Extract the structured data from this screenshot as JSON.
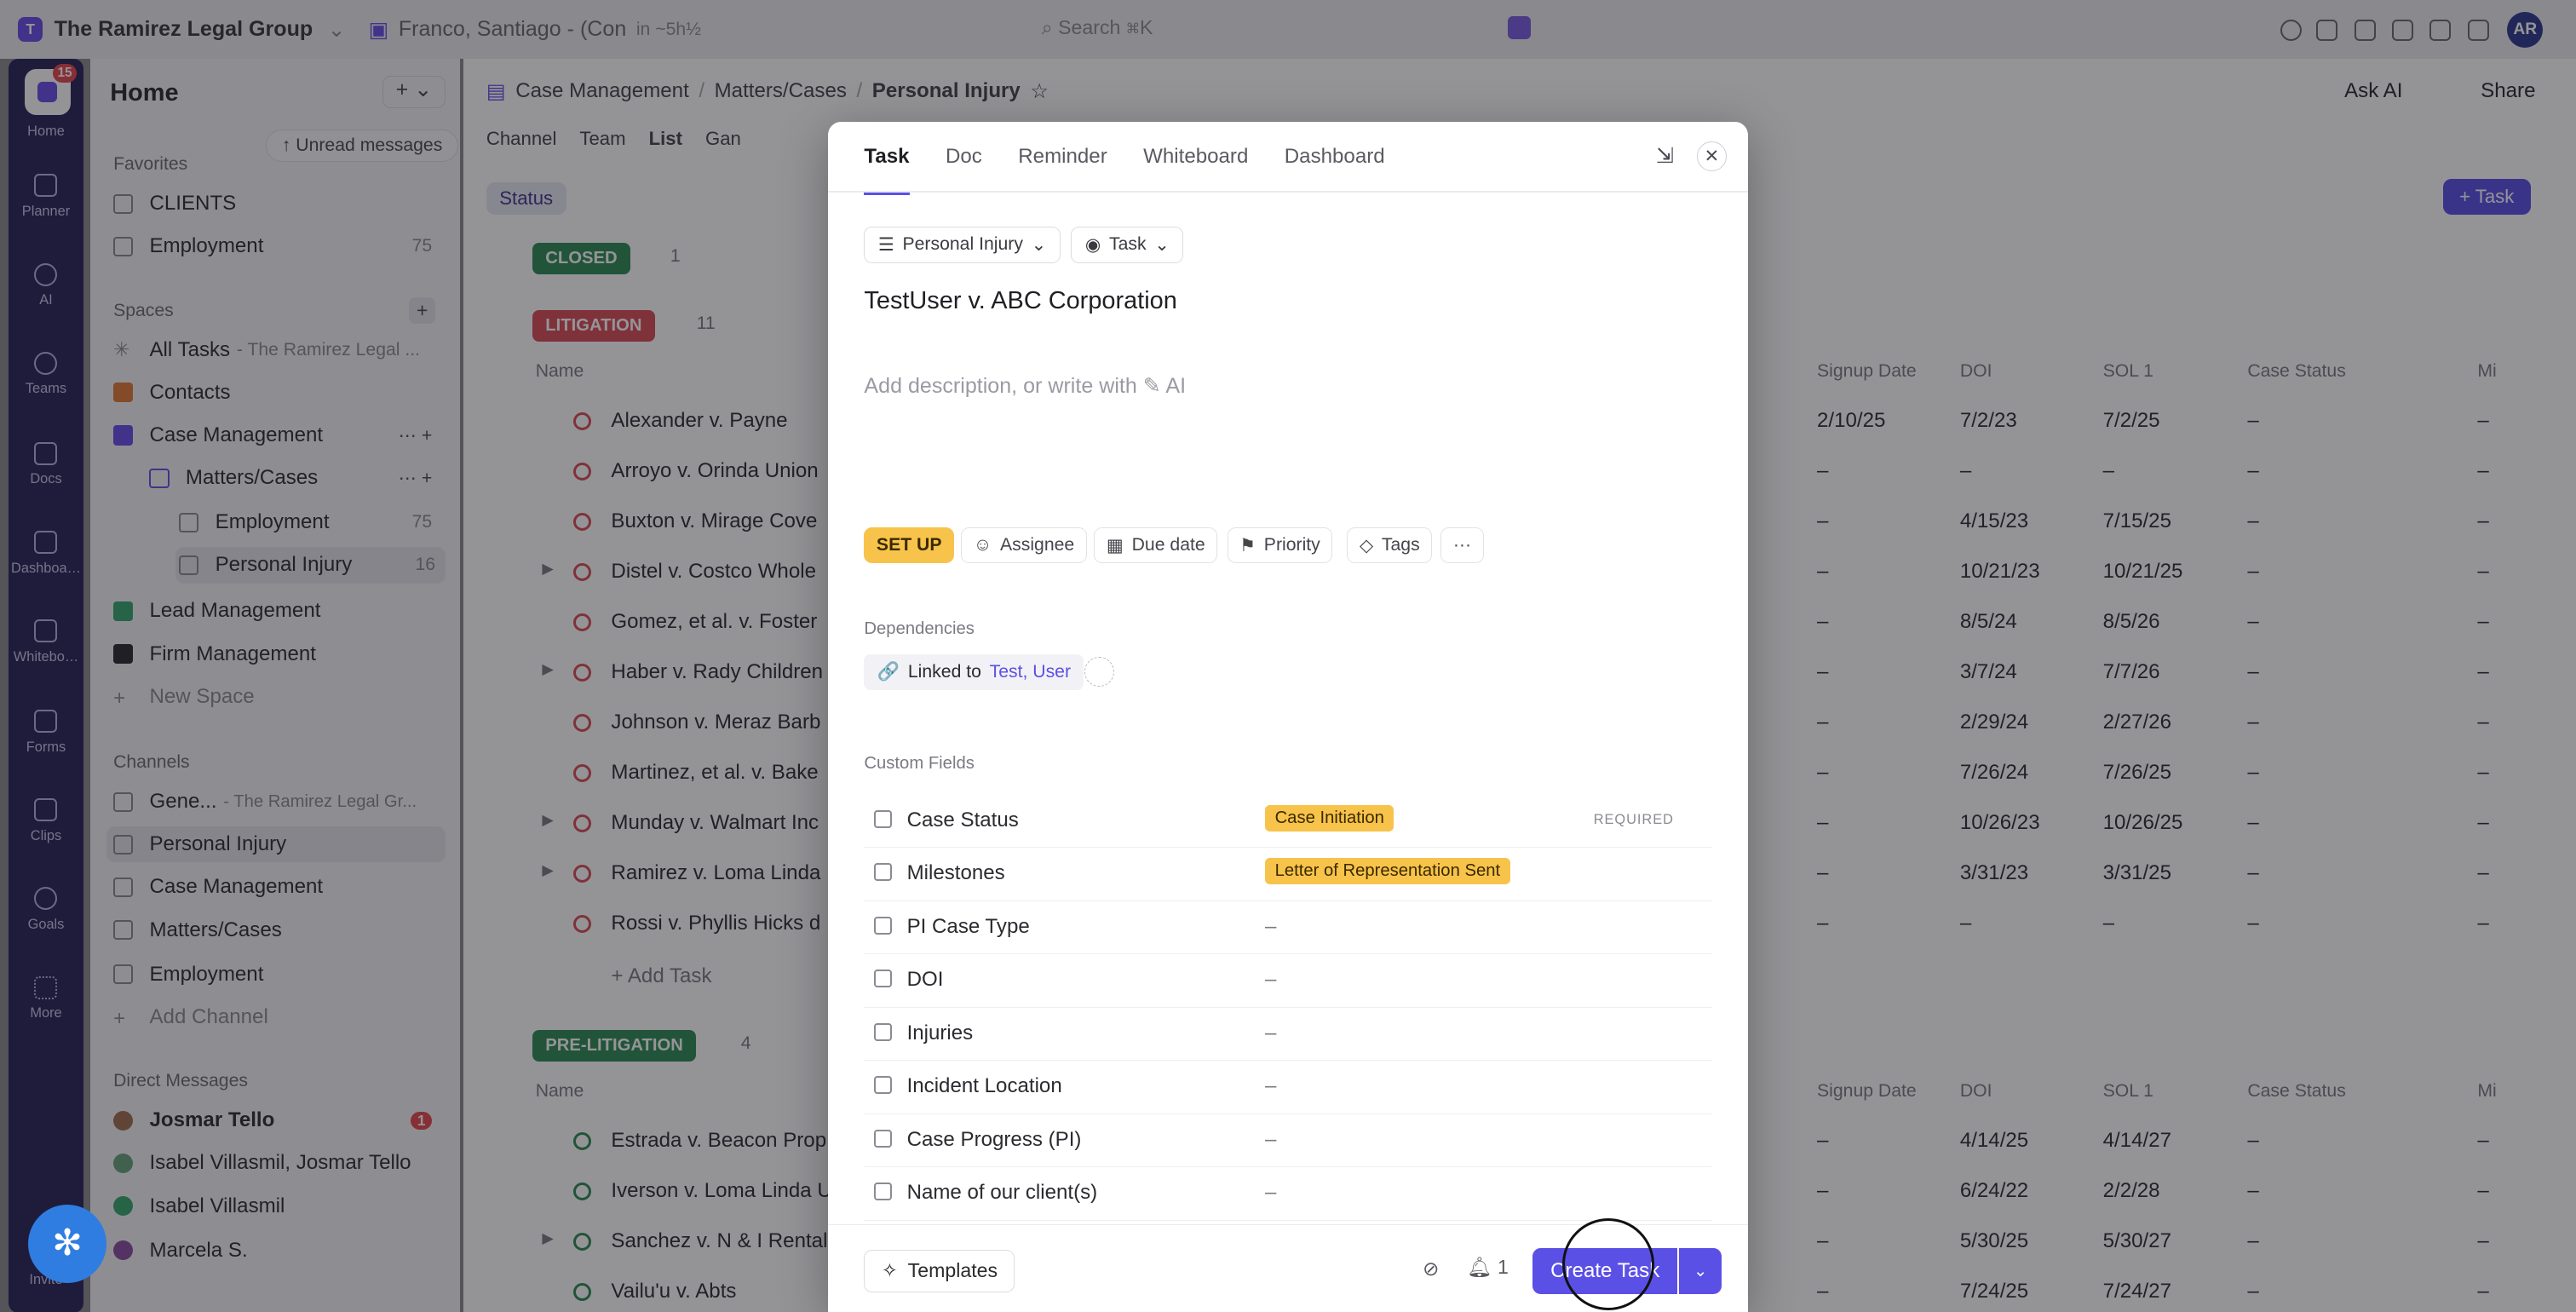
{
  "topbar": {
    "workspace": "The Ramirez Legal Group",
    "workspace_initial": "T",
    "tab": "Franco, Santiago - (Con",
    "tab_time": "in ~5h½",
    "search": "Search ⌘K",
    "avatar": "AR"
  },
  "rail": {
    "badge": "15",
    "items": [
      "Home",
      "Planner",
      "AI",
      "Teams",
      "Docs",
      "Dashboa…",
      "Whitebo…",
      "Forms",
      "Clips",
      "Goals",
      "More",
      "Invite"
    ]
  },
  "sidebar": {
    "title": "Home",
    "unread": "↑ Unread messages",
    "favorites": "Favorites",
    "fav": [
      {
        "label": "CLIENTS",
        "count": ""
      },
      {
        "label": "Employment",
        "count": "75"
      }
    ],
    "spaces_label": "Spaces",
    "all_tasks": "All Tasks",
    "all_tasks_sub": "- The Ramirez Legal ...",
    "spaces": [
      "Contacts",
      "Case Management",
      "Matters/Cases",
      "Employment",
      "Personal Injury",
      "Lead Management",
      "Firm Management",
      "New Space"
    ],
    "space_counts": {
      "employment": "75",
      "pi": "16"
    },
    "channels_label": "Channels",
    "channels": [
      "Gene...",
      "Personal Injury",
      "Case Management",
      "Matters/Cases",
      "Employment",
      "Add Channel"
    ],
    "channel_gen_sub": "- The Ramirez Legal Gr...",
    "dm_label": "Direct Messages",
    "dms": [
      "Josmar Tello",
      "Isabel Villasmil, Josmar Tello",
      "Isabel Villasmil",
      "Marcela S."
    ],
    "dm_badge": "1"
  },
  "main": {
    "crumbs": [
      "Case Management",
      "/",
      "Matters/Cases",
      "/",
      "Personal Injury"
    ],
    "tabs": [
      "Channel",
      "Team",
      "List",
      "Gan"
    ],
    "status_btn": "Status",
    "ask_ai": "Ask AI",
    "share": "Share",
    "task_btn": "+ Task",
    "groups": {
      "closed": "CLOSED",
      "closed_n": "1",
      "lit": "LITIGATION",
      "lit_n": "11",
      "pre": "PRE-LITIGATION",
      "pre_n": "4"
    },
    "cols": [
      "Name",
      "Signup Date",
      "DOI",
      "SOL 1",
      "Case Status",
      "Mi"
    ],
    "lit_rows": [
      {
        "n": "Alexander v. Payne",
        "s": "2/10/25",
        "d": "7/2/23",
        "l": "7/2/25",
        "c": "–",
        "m": "–"
      },
      {
        "n": "Arroyo v. Orinda Union",
        "s": "–",
        "d": "–",
        "l": "–",
        "c": "–",
        "m": "–"
      },
      {
        "n": "Buxton v. Mirage Cove",
        "s": "–",
        "d": "4/15/23",
        "l": "7/15/25",
        "c": "–",
        "m": "–"
      },
      {
        "n": "Distel v. Costco Whole",
        "s": "–",
        "d": "10/21/23",
        "l": "10/21/25",
        "c": "–",
        "m": "–"
      },
      {
        "n": "Gomez, et al. v. Foster",
        "s": "–",
        "d": "8/5/24",
        "l": "8/5/26",
        "c": "–",
        "m": "–"
      },
      {
        "n": "Haber v. Rady Children",
        "s": "–",
        "d": "3/7/24",
        "l": "7/7/26",
        "c": "–",
        "m": "–"
      },
      {
        "n": "Johnson v. Meraz Barb",
        "s": "–",
        "d": "2/29/24",
        "l": "2/27/26",
        "c": "–",
        "m": "–"
      },
      {
        "n": "Martinez, et al. v. Bake",
        "s": "–",
        "d": "7/26/24",
        "l": "7/26/25",
        "c": "–",
        "m": "–"
      },
      {
        "n": "Munday v. Walmart Inc",
        "s": "–",
        "d": "10/26/23",
        "l": "10/26/25",
        "c": "–",
        "m": "–"
      },
      {
        "n": "Ramirez v. Loma Linda",
        "s": "–",
        "d": "3/31/23",
        "l": "3/31/25",
        "c": "–",
        "m": "–"
      },
      {
        "n": "Rossi v. Phyllis Hicks d",
        "s": "–",
        "d": "–",
        "l": "–",
        "c": "–",
        "m": "–"
      }
    ],
    "add_task": "Add Task",
    "pre_rows": [
      {
        "n": "Estrada v. Beacon Prop",
        "s": "–",
        "d": "4/14/25",
        "l": "4/14/27",
        "c": "–",
        "m": "–"
      },
      {
        "n": "Iverson v. Loma Linda U",
        "s": "–",
        "d": "6/24/22",
        "l": "2/2/28",
        "c": "–",
        "m": "–"
      },
      {
        "n": "Sanchez v. N & I Rental",
        "s": "–",
        "d": "5/30/25",
        "l": "5/30/27",
        "c": "–",
        "m": "–"
      },
      {
        "n": "Vailu'u v. Abts",
        "s": "–",
        "d": "7/24/25",
        "l": "7/24/27",
        "c": "–",
        "m": "–"
      }
    ]
  },
  "modal": {
    "tabs": [
      "Task",
      "Doc",
      "Reminder",
      "Whiteboard",
      "Dashboard"
    ],
    "list_chip": "Personal Injury",
    "type_chip": "Task",
    "title": "TestUser v. ABC Corporation",
    "desc": "Add description, or write with",
    "desc_ai": "AI",
    "props": [
      "SET UP",
      "Assignee",
      "Due date",
      "Priority",
      "Tags",
      "···"
    ],
    "dep_label": "Dependencies",
    "linked_to": "Linked to",
    "linked_user": "Test, User",
    "cf_label": "Custom Fields",
    "fields": [
      {
        "label": "Case Status",
        "value": "Case Initiation",
        "tag": true,
        "required": "REQUIRED"
      },
      {
        "label": "Milestones",
        "value": "Letter of Representation Sent",
        "tag": true
      },
      {
        "label": "PI Case Type",
        "value": "–"
      },
      {
        "label": "DOI",
        "value": "–"
      },
      {
        "label": "Injuries",
        "value": "–"
      },
      {
        "label": "Incident Location",
        "value": "–"
      },
      {
        "label": "Case Progress (PI)",
        "value": "–"
      },
      {
        "label": "Name of our client(s)",
        "value": "–"
      }
    ],
    "templates": "Templates",
    "bell_count": "1",
    "create": "Create Task"
  },
  "colors": {
    "accent": "#5b50e6",
    "litigation": "#d94d56",
    "closed": "#2f8a55",
    "pre": "#2f8a55",
    "tag": "#f7c34a"
  }
}
